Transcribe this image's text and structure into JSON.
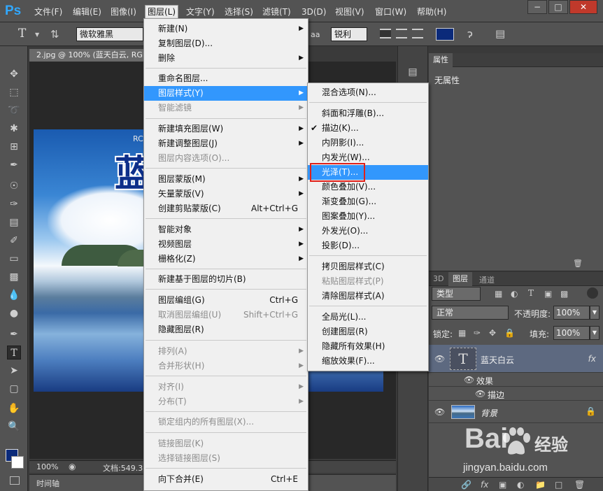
{
  "menubar": {
    "logo": "Ps",
    "items": [
      "文件(F)",
      "编辑(E)",
      "图像(I)",
      "图层(L)",
      "文字(Y)",
      "选择(S)",
      "滤镜(T)",
      "3D(D)",
      "视图(V)",
      "窗口(W)",
      "帮助(H)"
    ],
    "window_buttons": [
      "−",
      "□",
      "✕"
    ]
  },
  "options": {
    "font_family": "微软雅黑",
    "aa_label": "aa",
    "aa_value": "锐利"
  },
  "document": {
    "tab_title": "2.jpg @ 100% (蓝天白云, RGB/8) *",
    "canvas_text": "蓝",
    "canvas_small_text": "RC",
    "zoom": "100%",
    "doc_info": "文档:549.3"
  },
  "timeline_label": "时间轴",
  "properties": {
    "tab": "属性",
    "empty_text": "无属性"
  },
  "layers": {
    "tabs": [
      "3D",
      "图层",
      "通道"
    ],
    "filter_kind": "类型",
    "blend_mode": "正常",
    "opacity_label": "不透明度:",
    "opacity_value": "100%",
    "lock_label": "锁定:",
    "fill_label": "填充:",
    "fill_value": "100%",
    "text_layer_name": "蓝天白云",
    "fx": "fx",
    "effects_label": "效果",
    "stroke_label": "描边",
    "bg_layer_name": "背景"
  },
  "layer_menu": {
    "items": [
      {
        "label": "新建(N)",
        "arrow": true
      },
      {
        "label": "复制图层(D)..."
      },
      {
        "label": "删除",
        "arrow": true
      },
      {
        "label": "重命名图层..."
      },
      {
        "label": "图层样式(Y)",
        "arrow": true,
        "highlight": true
      },
      {
        "label": "智能滤镜",
        "arrow": true,
        "disabled": true
      },
      {
        "label": "新建填充图层(W)",
        "arrow": true
      },
      {
        "label": "新建调整图层(J)",
        "arrow": true
      },
      {
        "label": "图层内容选项(O)...",
        "disabled": true
      },
      {
        "label": "图层蒙版(M)",
        "arrow": true
      },
      {
        "label": "矢量蒙版(V)",
        "arrow": true
      },
      {
        "label": "创建剪贴蒙版(C)",
        "shortcut": "Alt+Ctrl+G"
      },
      {
        "label": "智能对象",
        "arrow": true
      },
      {
        "label": "视频图层",
        "arrow": true
      },
      {
        "label": "栅格化(Z)",
        "arrow": true
      },
      {
        "label": "新建基于图层的切片(B)"
      },
      {
        "label": "图层编组(G)",
        "shortcut": "Ctrl+G"
      },
      {
        "label": "取消图层编组(U)",
        "shortcut": "Shift+Ctrl+G",
        "disabled": true
      },
      {
        "label": "隐藏图层(R)"
      },
      {
        "label": "排列(A)",
        "arrow": true,
        "disabled": true
      },
      {
        "label": "合并形状(H)",
        "arrow": true,
        "disabled": true
      },
      {
        "label": "对齐(I)",
        "arrow": true,
        "disabled": true
      },
      {
        "label": "分布(T)",
        "arrow": true,
        "disabled": true
      },
      {
        "label": "锁定组内的所有图层(X)...",
        "disabled": true
      },
      {
        "label": "链接图层(K)",
        "disabled": true
      },
      {
        "label": "选择链接图层(S)",
        "disabled": true
      },
      {
        "label": "向下合并(E)",
        "shortcut": "Ctrl+E"
      }
    ]
  },
  "style_menu": {
    "items": [
      {
        "label": "混合选项(N)..."
      },
      {
        "label": "斜面和浮雕(B)..."
      },
      {
        "label": "描边(K)...",
        "checked": true
      },
      {
        "label": "内阴影(I)..."
      },
      {
        "label": "内发光(W)..."
      },
      {
        "label": "光泽(T)...",
        "highlight": true
      },
      {
        "label": "颜色叠加(V)..."
      },
      {
        "label": "渐变叠加(G)..."
      },
      {
        "label": "图案叠加(Y)..."
      },
      {
        "label": "外发光(O)..."
      },
      {
        "label": "投影(D)..."
      },
      {
        "label": "拷贝图层样式(C)"
      },
      {
        "label": "粘贴图层样式(P)",
        "disabled": true
      },
      {
        "label": "清除图层样式(A)"
      },
      {
        "label": "全局光(L)..."
      },
      {
        "label": "创建图层(R)"
      },
      {
        "label": "隐藏所有效果(H)"
      },
      {
        "label": "缩放效果(F)..."
      }
    ]
  },
  "watermark": {
    "brand": "Bai",
    "brand_cn": "经验",
    "url": "jingyan.baidu.com"
  },
  "colors": {
    "accent": "#3297fd",
    "foreground": "#0b2a7a",
    "highlight_box": "#e0201a"
  }
}
